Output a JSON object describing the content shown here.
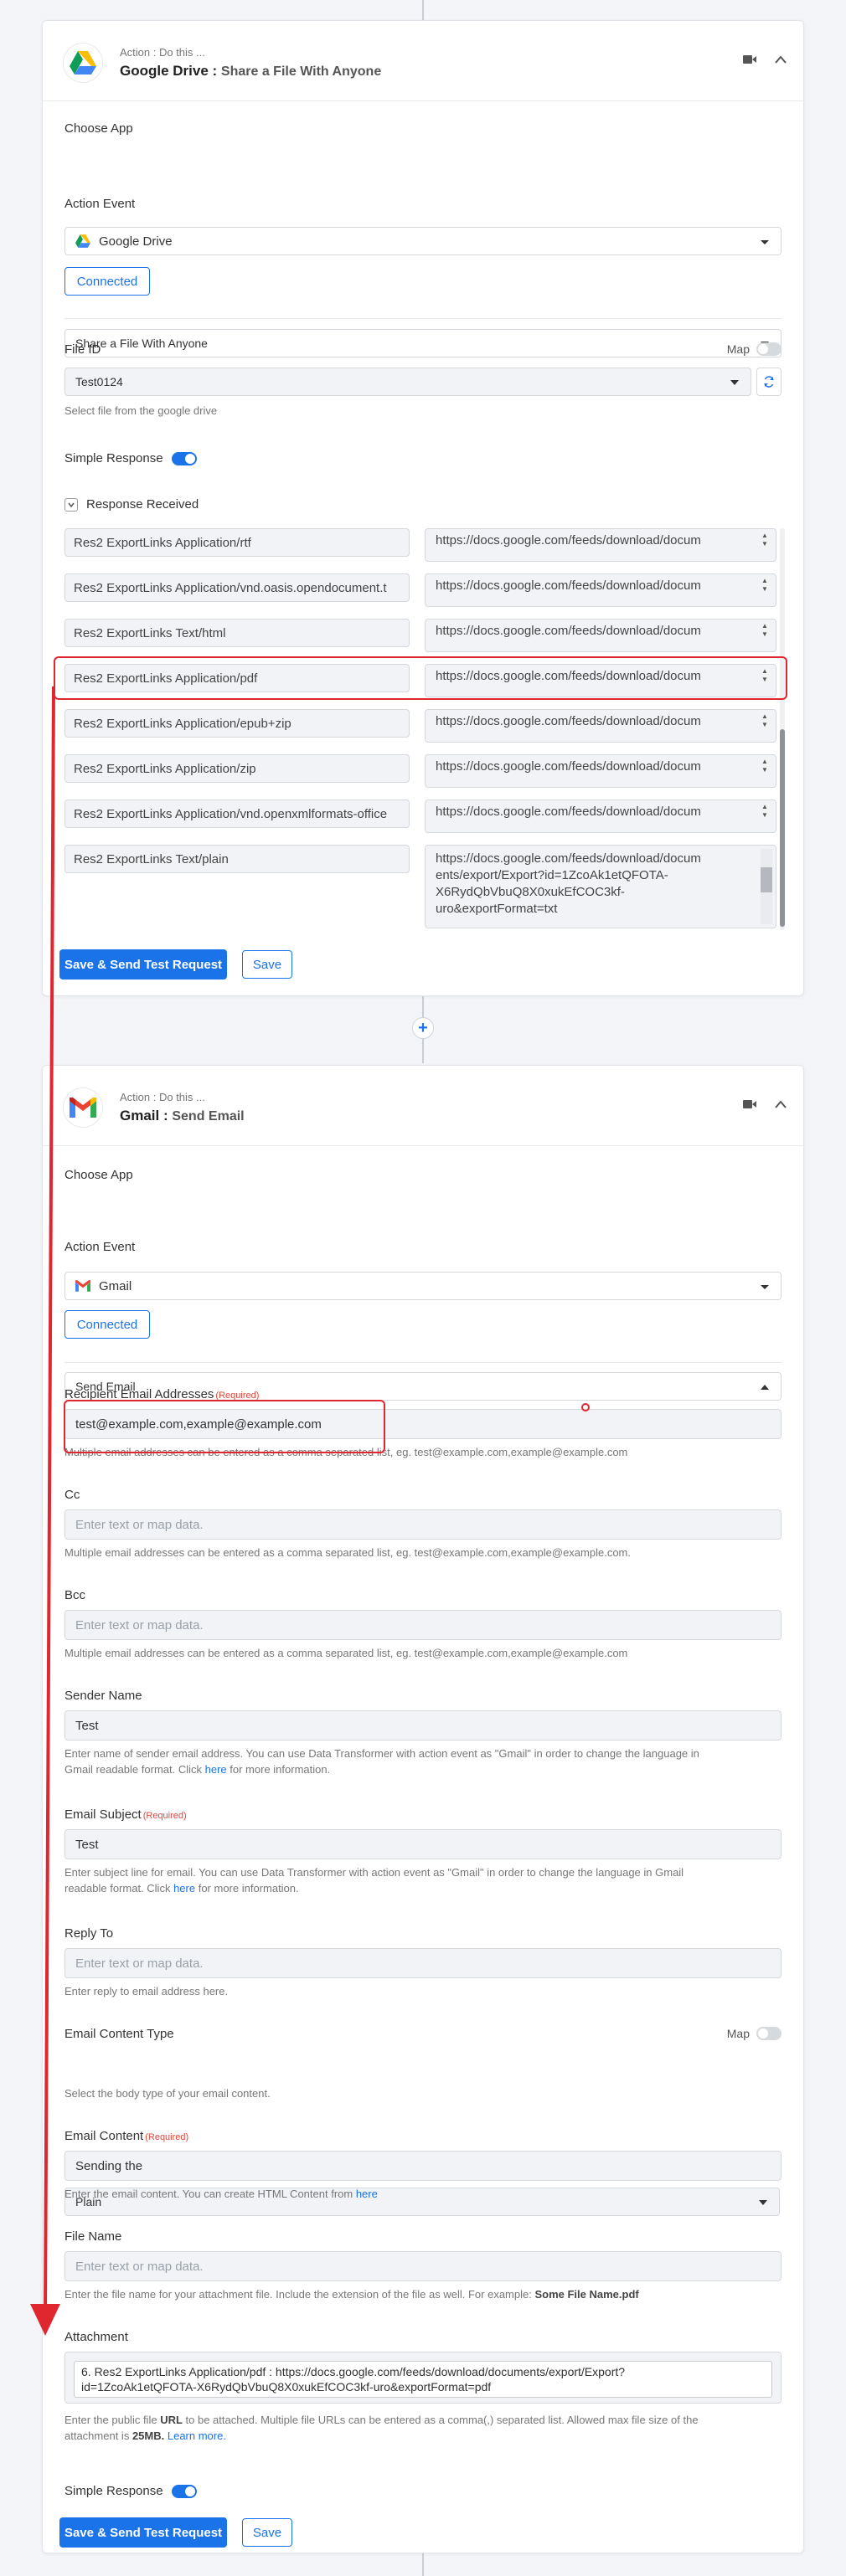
{
  "drive": {
    "action_hint": "Action : Do this ...",
    "app_name": "Google Drive :",
    "action_name": "Share a File With Anyone",
    "choose_app_label": "Choose App",
    "choose_app_value": "Google Drive",
    "action_event_label": "Action Event",
    "action_event_value": "Share a File With Anyone",
    "connected_label": "Connected",
    "file_id_label": "File ID",
    "map_label": "Map",
    "file_id_value": "Test0124",
    "file_id_help": "Select file from the google drive",
    "simple_response_label": "Simple Response",
    "response_received_label": "Response Received",
    "responses": [
      {
        "key": "Res2 ExportLinks Application/rtf",
        "value": "https://docs.google.com/feeds/download/docum"
      },
      {
        "key": "Res2 ExportLinks Application/vnd.oasis.opendocument.t",
        "value": "https://docs.google.com/feeds/download/docum"
      },
      {
        "key": "Res2 ExportLinks Text/html",
        "value": "https://docs.google.com/feeds/download/docum"
      },
      {
        "key": "Res2 ExportLinks Application/pdf",
        "value": "https://docs.google.com/feeds/download/docum"
      },
      {
        "key": "Res2 ExportLinks Application/epub+zip",
        "value": "https://docs.google.com/feeds/download/docum"
      },
      {
        "key": "Res2 ExportLinks Application/zip",
        "value": "https://docs.google.com/feeds/download/docum"
      },
      {
        "key": "Res2 ExportLinks Application/vnd.openxmlformats-office",
        "value": "https://docs.google.com/feeds/download/docum"
      }
    ],
    "last_response_key": "Res2 ExportLinks Text/plain",
    "last_response_lines": [
      "https://docs.google.com/feeds/download/docum",
      "ents/export/Export?id=1ZcoAk1etQFOTA-",
      "X6RydQbVbuQ8X0xukEfCOC3kf-",
      "uro&exportFormat=txt"
    ],
    "save_send_label": "Save & Send Test Request",
    "save_label": "Save"
  },
  "gmail": {
    "action_hint": "Action : Do this ...",
    "app_name": "Gmail :",
    "action_name": "Send Email",
    "choose_app_label": "Choose App",
    "choose_app_value": "Gmail",
    "action_event_label": "Action Event",
    "action_event_value": "Send Email",
    "connected_label": "Connected",
    "recipient_label": "Recipient Email Addresses",
    "required": "(Required)",
    "recipient_value": "test@example.com,example@example.com",
    "recipient_help": "Multiple email addresses can be entered as a comma separated list, eg. test@example.com,example@example.com",
    "cc_label": "Cc",
    "placeholder": "Enter text or map data.",
    "cc_help": "Multiple email addresses can be entered as a comma separated list, eg. test@example.com,example@example.com.",
    "bcc_label": "Bcc",
    "bcc_help": "Multiple email addresses can be entered as a comma separated list, eg. test@example.com,example@example.com",
    "sender_label": "Sender Name",
    "sender_value": "Test",
    "sender_help_1": "Enter name of sender email address. You can use Data Transformer with action event as \"Gmail\" in order to change the language in",
    "sender_help_2": "Gmail readable format. Click ",
    "here": "here",
    "sender_help_3": " for more information.",
    "subject_label": "Email Subject",
    "subject_value": "Test",
    "subject_help_1": "Enter subject line for email. You can use Data Transformer with action event as \"Gmail\" in order to change the language in Gmail",
    "subject_help_2": "readable format. Click ",
    "subject_help_3": " for more information.",
    "reply_label": "Reply To",
    "reply_help": "Enter reply to email address here.",
    "content_type_label": "Email Content Type",
    "map_label": "Map",
    "content_type_value": "Plain",
    "content_type_help": "Select the body type of your email content.",
    "content_label": "Email Content",
    "content_value": "Sending the",
    "content_help": "Enter the email content. You can create HTML Content from ",
    "file_name_label": "File Name",
    "file_name_help": "Enter the file name for your attachment file. Include the extension of the file as well. For example: ",
    "file_name_example": "Some File Name.pdf",
    "attachment_label": "Attachment",
    "attachment_line1": "6. Res2 ExportLinks Application/pdf : https://docs.google.com/feeds/download/documents/export/Export?",
    "attachment_line2": "id=1ZcoAk1etQFOTA-X6RydQbVbuQ8X0xukEfCOC3kf-uro&exportFormat=pdf",
    "attachment_help_1": "Enter the public file ",
    "url": "URL",
    "attachment_help_2": " to be attached. Multiple file URLs can be entered as a comma(,) separated list. Allowed max file size of the",
    "attachment_help_3": "attachment is ",
    "size": "25MB.",
    "learn_more": "Learn more.",
    "simple_response_label": "Simple Response",
    "save_send_label": "Save & Send Test Request",
    "save_label": "Save"
  },
  "colors": {
    "primary": "#1a73e8",
    "highlight": "#e0262e",
    "required": "#e0463a"
  }
}
